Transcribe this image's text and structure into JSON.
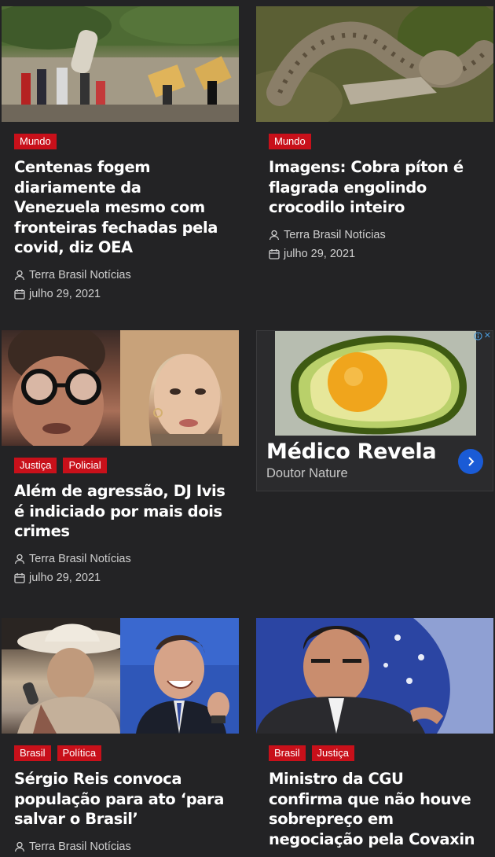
{
  "articles": [
    {
      "tags": [
        "Mundo"
      ],
      "title": "Centenas fogem diariamente da Venezuela mesmo com fronteiras fechadas pela covid, diz OEA",
      "author": "Terra Brasil Notícias",
      "date": "julho 29, 2021"
    },
    {
      "tags": [
        "Mundo"
      ],
      "title": "Imagens: Cobra píton é flagrada engolindo crocodilo inteiro",
      "author": "Terra Brasil Notícias",
      "date": "julho 29, 2021"
    },
    {
      "tags": [
        "Justiça",
        "Policial"
      ],
      "title": "Além de agressão, DJ Ivis é indiciado por mais dois crimes",
      "author": "Terra Brasil Notícias",
      "date": "julho 29, 2021"
    },
    {
      "tags": [
        "Brasil",
        "Política"
      ],
      "title": "Sérgio Reis convoca população para ato ‘para salvar o Brasil’",
      "author": "Terra Brasil Notícias"
    },
    {
      "tags": [
        "Brasil",
        "Justiça"
      ],
      "title": "Ministro da CGU confirma que não houve sobrepreço em negociação pela Covaxin"
    }
  ],
  "ad": {
    "title": "Médico Revela",
    "sponsor": "Doutor Nature",
    "choices_icon": "info-icon",
    "close_label": "✕"
  },
  "colors": {
    "background": "#232325",
    "tag": "#c8101a",
    "ad_button": "#1a5bd6"
  }
}
